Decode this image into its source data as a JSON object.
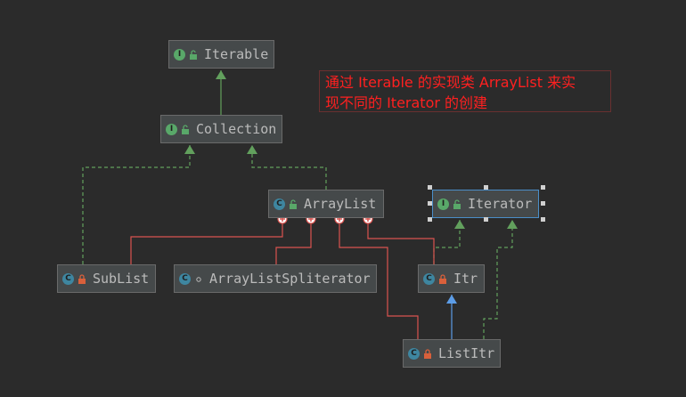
{
  "diagram": {
    "nodes": [
      {
        "id": "iterable",
        "label": "Iterable",
        "kind": "interface"
      },
      {
        "id": "collection",
        "label": "Collection",
        "kind": "interface"
      },
      {
        "id": "arraylist",
        "label": "ArrayList",
        "kind": "class"
      },
      {
        "id": "iterator",
        "label": "Iterator",
        "kind": "interface"
      },
      {
        "id": "sublist",
        "label": "SubList",
        "kind": "class"
      },
      {
        "id": "spliterator",
        "label": "ArrayListSpliterator",
        "kind": "class"
      },
      {
        "id": "itr",
        "label": "Itr",
        "kind": "class"
      },
      {
        "id": "listitr",
        "label": "ListItr",
        "kind": "class"
      }
    ],
    "edges": [
      {
        "from": "collection",
        "to": "iterable",
        "type": "extends"
      },
      {
        "from": "arraylist",
        "to": "collection",
        "type": "implements"
      },
      {
        "from": "sublist",
        "to": "collection",
        "type": "implements"
      },
      {
        "from": "listitr",
        "to": "itr",
        "type": "extends"
      },
      {
        "from": "itr",
        "to": "iterator",
        "type": "implements"
      },
      {
        "from": "listitr",
        "to": "iterator",
        "type": "implements"
      },
      {
        "from": "sublist",
        "to": "arraylist",
        "type": "inner"
      },
      {
        "from": "spliterator",
        "to": "arraylist",
        "type": "inner"
      },
      {
        "from": "listitr",
        "to": "arraylist",
        "type": "inner"
      },
      {
        "from": "itr",
        "to": "arraylist",
        "type": "inner"
      }
    ],
    "note": {
      "line1": "通过 Iterable 的实现类 ArrayList 来实",
      "line2": "现不同的 Iterator 的创建"
    },
    "selected": "iterator",
    "colors": {
      "background": "#2b2b2b",
      "node_fill": "#45494a",
      "node_border": "#6a6a6a",
      "extends": "#62a05d",
      "implements": "#62a05d",
      "class_extends": "#5c9ce6",
      "inner": "#d9534f",
      "note_text": "#ff2020",
      "selected_border": "#4b8ec8"
    }
  }
}
